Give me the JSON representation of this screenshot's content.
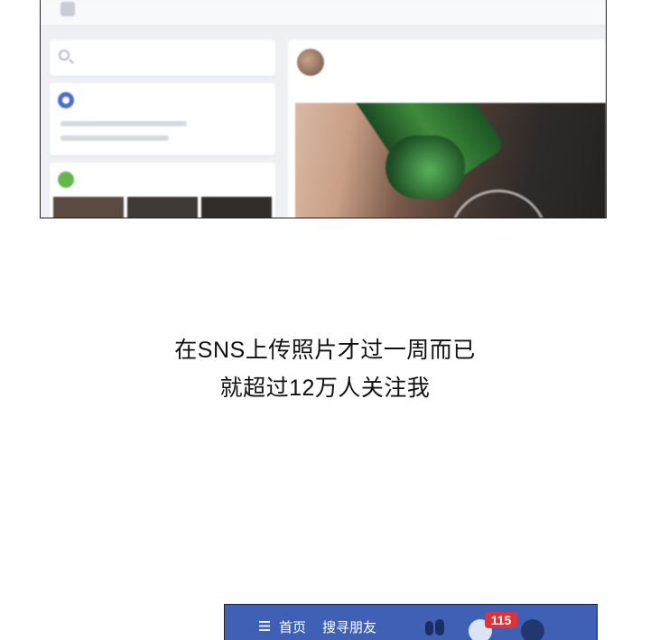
{
  "caption": {
    "line1": "在SNS上传照片才过一周而已",
    "line2": "就超过12万人关注我"
  },
  "bottom_nav": {
    "home_label": "首页",
    "find_friends_label": "搜寻朋友",
    "notification_count": "115"
  },
  "colors": {
    "nav_bar": "#3f60b4",
    "badge": "#e0323a",
    "caption_text": "#111111"
  }
}
